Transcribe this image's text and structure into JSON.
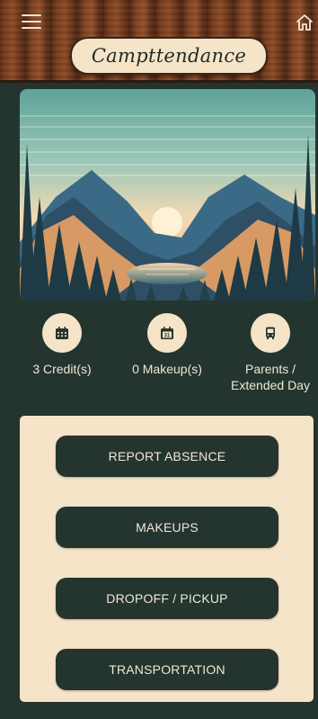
{
  "header": {
    "title": "Campttendance",
    "menu_icon": "hamburger-menu-icon",
    "home_icon": "home-icon"
  },
  "hero": {
    "description_icon": "mountain-lake-sunset-illustration"
  },
  "stats": [
    {
      "icon": "calendar-grid-icon",
      "label": "3 Credit(s)"
    },
    {
      "icon": "calendar-31-icon",
      "label": "0 Makeup(s)"
    },
    {
      "icon": "bus-icon",
      "label_line1": "Parents /",
      "label_line2": "Extended Day"
    }
  ],
  "actions": {
    "report_absence": "REPORT ABSENCE",
    "makeups": "MAKEUPS",
    "dropoff_pickup": "DROPOFF / PICKUP",
    "transportation": "TRANSPORTATION"
  },
  "colors": {
    "background": "#243530",
    "cream": "#f6e4c8",
    "wood": "#7a3e1f"
  }
}
